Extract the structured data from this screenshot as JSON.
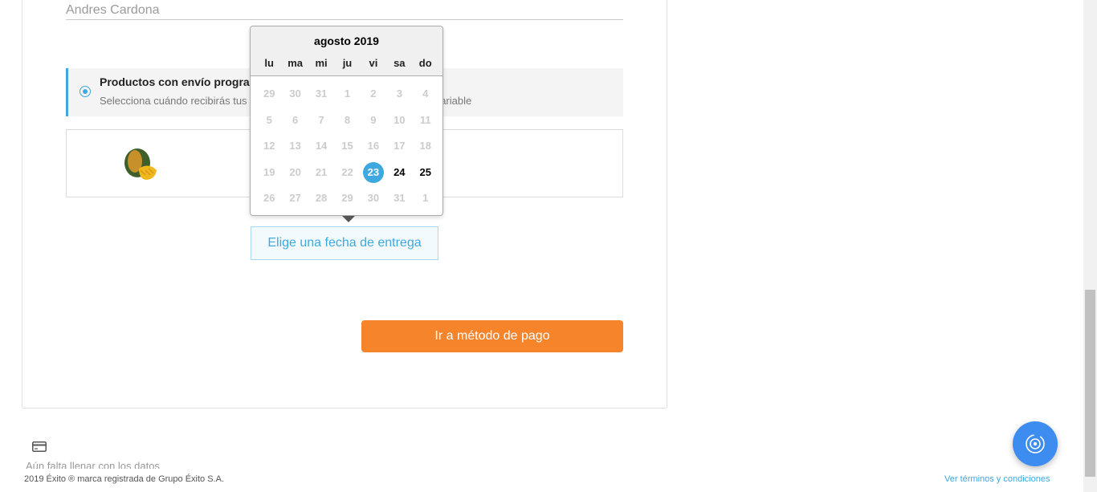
{
  "form": {
    "name_value": "Andres Cardona"
  },
  "scheduled": {
    "title": "Productos con envío programado",
    "subtitle": "Selecciona cuándo recibirás tus productos, el costo del envío puede ser variable"
  },
  "datepicker": {
    "month_title": "agosto 2019",
    "weekdays": [
      "lu",
      "ma",
      "mi",
      "ju",
      "vi",
      "sa",
      "do"
    ],
    "weeks": [
      [
        "29",
        "30",
        "31",
        "1",
        "2",
        "3",
        "4"
      ],
      [
        "5",
        "6",
        "7",
        "8",
        "9",
        "10",
        "11"
      ],
      [
        "12",
        "13",
        "14",
        "15",
        "16",
        "17",
        "18"
      ],
      [
        "19",
        "20",
        "21",
        "22",
        "23",
        "24",
        "25"
      ],
      [
        "26",
        "27",
        "28",
        "29",
        "30",
        "31",
        "1"
      ]
    ],
    "selected_day": "23",
    "enabled_days": [
      "23",
      "24",
      "25"
    ]
  },
  "buttons": {
    "choose_date": "Elige una fecha de entrega",
    "go_to_payment": "Ir a método de pago"
  },
  "payment_section": {
    "missing_data_text": "Aún falta llenar con los datos"
  },
  "footer": {
    "copyright": "2019 Éxito ® marca registrada de Grupo Éxito S.A.",
    "terms_link": "Ver términos y condiciones"
  },
  "icons": {
    "payment_card": "credit-card-icon",
    "fab": "chat-assistant-icon",
    "product": "mango-image"
  },
  "colors": {
    "accent_blue": "#3da9e0",
    "primary_orange": "#f5842a",
    "fab_blue": "#3d8cf0"
  }
}
